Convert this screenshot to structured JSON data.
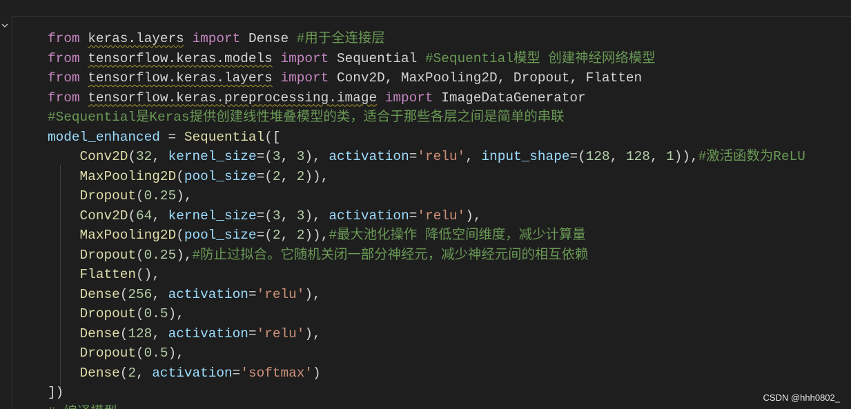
{
  "lines": [
    [
      [
        "kw",
        "from"
      ],
      [
        "pun",
        " "
      ],
      [
        "mod",
        "keras.layers"
      ],
      [
        "pun",
        " "
      ],
      [
        "kw",
        "import"
      ],
      [
        "pun",
        " "
      ],
      [
        "name",
        "Dense"
      ],
      [
        "pun",
        " "
      ],
      [
        "com",
        "#用于全连接层"
      ]
    ],
    [
      [
        "kw",
        "from"
      ],
      [
        "pun",
        " "
      ],
      [
        "mod",
        "tensorflow.keras.models"
      ],
      [
        "pun",
        " "
      ],
      [
        "kw",
        "import"
      ],
      [
        "pun",
        " "
      ],
      [
        "name",
        "Sequential"
      ],
      [
        "pun",
        " "
      ],
      [
        "com",
        "#Sequential模型 创建神经网络模型"
      ]
    ],
    [
      [
        "kw",
        "from"
      ],
      [
        "pun",
        " "
      ],
      [
        "mod",
        "tensorflow.keras.layers"
      ],
      [
        "pun",
        " "
      ],
      [
        "kw",
        "import"
      ],
      [
        "pun",
        " "
      ],
      [
        "name",
        "Conv2D, MaxPooling2D, Dropout, Flatten"
      ]
    ],
    [
      [
        "kw",
        "from"
      ],
      [
        "pun",
        " "
      ],
      [
        "mod",
        "tensorflow.keras.preprocessing.image"
      ],
      [
        "pun",
        " "
      ],
      [
        "kw",
        "import"
      ],
      [
        "pun",
        " "
      ],
      [
        "name",
        "ImageDataGenerator"
      ]
    ],
    [
      [
        "com",
        "#Sequential是Keras提供创建线性堆叠模型的类，适合于那些各层之间是简单的串联"
      ]
    ],
    [
      [
        "var",
        "model_enhanced"
      ],
      [
        "pun",
        " = "
      ],
      [
        "cls",
        "Sequential"
      ],
      [
        "pun",
        "(["
      ]
    ],
    [
      [
        "pun",
        "    "
      ],
      [
        "cls",
        "Conv2D"
      ],
      [
        "pun",
        "("
      ],
      [
        "num",
        "32"
      ],
      [
        "pun",
        ", "
      ],
      [
        "var",
        "kernel_size"
      ],
      [
        "pun",
        "=("
      ],
      [
        "num",
        "3"
      ],
      [
        "pun",
        ", "
      ],
      [
        "num",
        "3"
      ],
      [
        "pun",
        "), "
      ],
      [
        "var",
        "activation"
      ],
      [
        "pun",
        "="
      ],
      [
        "str",
        "'relu'"
      ],
      [
        "pun",
        ", "
      ],
      [
        "var",
        "input_shape"
      ],
      [
        "pun",
        "=("
      ],
      [
        "num",
        "128"
      ],
      [
        "pun",
        ", "
      ],
      [
        "num",
        "128"
      ],
      [
        "pun",
        ", "
      ],
      [
        "num",
        "1"
      ],
      [
        "pun",
        ")),"
      ],
      [
        "com",
        "#激活函数为ReLU"
      ]
    ],
    [
      [
        "pun",
        "    "
      ],
      [
        "cls",
        "MaxPooling2D"
      ],
      [
        "pun",
        "("
      ],
      [
        "var",
        "pool_size"
      ],
      [
        "pun",
        "=("
      ],
      [
        "num",
        "2"
      ],
      [
        "pun",
        ", "
      ],
      [
        "num",
        "2"
      ],
      [
        "pun",
        ")),"
      ]
    ],
    [
      [
        "pun",
        "    "
      ],
      [
        "cls",
        "Dropout"
      ],
      [
        "pun",
        "("
      ],
      [
        "num",
        "0.25"
      ],
      [
        "pun",
        "),"
      ]
    ],
    [
      [
        "pun",
        "    "
      ],
      [
        "cls",
        "Conv2D"
      ],
      [
        "pun",
        "("
      ],
      [
        "num",
        "64"
      ],
      [
        "pun",
        ", "
      ],
      [
        "var",
        "kernel_size"
      ],
      [
        "pun",
        "=("
      ],
      [
        "num",
        "3"
      ],
      [
        "pun",
        ", "
      ],
      [
        "num",
        "3"
      ],
      [
        "pun",
        "), "
      ],
      [
        "var",
        "activation"
      ],
      [
        "pun",
        "="
      ],
      [
        "str",
        "'relu'"
      ],
      [
        "pun",
        "),"
      ]
    ],
    [
      [
        "pun",
        "    "
      ],
      [
        "cls",
        "MaxPooling2D"
      ],
      [
        "pun",
        "("
      ],
      [
        "var",
        "pool_size"
      ],
      [
        "pun",
        "=("
      ],
      [
        "num",
        "2"
      ],
      [
        "pun",
        ", "
      ],
      [
        "num",
        "2"
      ],
      [
        "pun",
        ")),"
      ],
      [
        "com",
        "#最大池化操作 降低空间维度，减少计算量"
      ]
    ],
    [
      [
        "pun",
        "    "
      ],
      [
        "cls",
        "Dropout"
      ],
      [
        "pun",
        "("
      ],
      [
        "num",
        "0.25"
      ],
      [
        "pun",
        "),"
      ],
      [
        "com",
        "#防止过拟合。它随机关闭一部分神经元，减少神经元间的相互依赖"
      ]
    ],
    [
      [
        "pun",
        "    "
      ],
      [
        "cls",
        "Flatten"
      ],
      [
        "pun",
        "(),"
      ]
    ],
    [
      [
        "pun",
        "    "
      ],
      [
        "cls",
        "Dense"
      ],
      [
        "pun",
        "("
      ],
      [
        "num",
        "256"
      ],
      [
        "pun",
        ", "
      ],
      [
        "var",
        "activation"
      ],
      [
        "pun",
        "="
      ],
      [
        "str",
        "'relu'"
      ],
      [
        "pun",
        "),"
      ]
    ],
    [
      [
        "pun",
        "    "
      ],
      [
        "cls",
        "Dropout"
      ],
      [
        "pun",
        "("
      ],
      [
        "num",
        "0.5"
      ],
      [
        "pun",
        "),"
      ]
    ],
    [
      [
        "pun",
        "    "
      ],
      [
        "cls",
        "Dense"
      ],
      [
        "pun",
        "("
      ],
      [
        "num",
        "128"
      ],
      [
        "pun",
        ", "
      ],
      [
        "var",
        "activation"
      ],
      [
        "pun",
        "="
      ],
      [
        "str",
        "'relu'"
      ],
      [
        "pun",
        "),"
      ]
    ],
    [
      [
        "pun",
        "    "
      ],
      [
        "cls",
        "Dropout"
      ],
      [
        "pun",
        "("
      ],
      [
        "num",
        "0.5"
      ],
      [
        "pun",
        "),"
      ]
    ],
    [
      [
        "pun",
        "    "
      ],
      [
        "cls",
        "Dense"
      ],
      [
        "pun",
        "("
      ],
      [
        "num",
        "2"
      ],
      [
        "pun",
        ", "
      ],
      [
        "var",
        "activation"
      ],
      [
        "pun",
        "="
      ],
      [
        "str",
        "'softmax'"
      ],
      [
        "pun",
        ")"
      ]
    ],
    [
      [
        "pun",
        "])"
      ]
    ],
    [
      [
        "com",
        "# 编译模型"
      ]
    ]
  ],
  "watermark": "CSDN @hhh0802_",
  "colors": {
    "keyword": "#c586c0",
    "class": "#dcdcaa",
    "variable": "#9cdcfe",
    "number": "#b5cea8",
    "string": "#ce9178",
    "comment": "#6a9955",
    "background": "#1e1e1e"
  },
  "icons": {
    "fold": "chevron-down-icon"
  }
}
